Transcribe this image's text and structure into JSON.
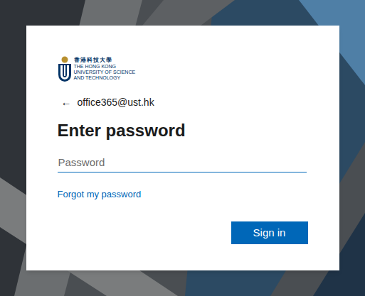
{
  "logo": {
    "chinese": "香港科技大學",
    "lines": [
      "THE HONG KONG",
      "UNIVERSITY OF SCIENCE",
      "AND TECHNOLOGY"
    ]
  },
  "account": {
    "back_icon": "←",
    "email": "office365@ust.hk"
  },
  "title": "Enter password",
  "password": {
    "placeholder": "Password"
  },
  "forgot_link": "Forgot my password",
  "buttons": [
    "Sign in"
  ]
}
